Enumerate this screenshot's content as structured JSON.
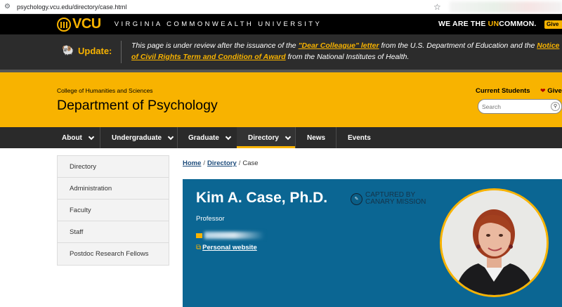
{
  "browser": {
    "url": "psychology.vcu.edu/directory/case.html"
  },
  "topbar": {
    "logo_text": "VCU",
    "university": "VIRGINIA COMMONWEALTH UNIVERSITY",
    "tagline_pre": "WE ARE THE ",
    "tagline_hl": "UN",
    "tagline_post": "COMMON.",
    "give_label": "Give"
  },
  "banner": {
    "label": "Update:",
    "text1": "This page is under review after the issuance of the ",
    "link1": "\"Dear Colleague\" letter",
    "text2": " from the U.S. Department of Education and the ",
    "link2": "Notice of Civil Rights Term and Condition of Award",
    "text3": " from the National Institutes of Health."
  },
  "header": {
    "college": "College of Humanities and Sciences",
    "department": "Department of Psychology",
    "current_students": "Current Students",
    "give": "Give",
    "search_placeholder": "Search"
  },
  "nav": {
    "items": [
      {
        "label": "About"
      },
      {
        "label": "Undergraduate"
      },
      {
        "label": "Graduate"
      },
      {
        "label": "Directory"
      },
      {
        "label": "News"
      },
      {
        "label": "Events"
      }
    ]
  },
  "sidebar": {
    "items": [
      {
        "label": "Directory"
      },
      {
        "label": "Administration"
      },
      {
        "label": "Faculty"
      },
      {
        "label": "Staff"
      },
      {
        "label": "Postdoc Research Fellows"
      }
    ]
  },
  "breadcrumb": {
    "home": "Home",
    "directory": "Directory",
    "current": "Case"
  },
  "profile": {
    "name": "Kim A. Case, Ph.D.",
    "title": "Professor",
    "website_label": "Personal website",
    "stamp_line1": "CAPTURED BY",
    "stamp_line2": "CANARY MISSION"
  },
  "colors": {
    "gold": "#f8b300",
    "black": "#000000",
    "profile_blue": "#0b6693",
    "nav_dark": "#2a2a2a"
  },
  "icons": {
    "browser_controls": "tune-icon",
    "bookmark": "star-icon",
    "banner": "ram-icon",
    "heart": "heart-icon",
    "search": "search-icon",
    "dropdown": "chevron-down-icon",
    "email": "envelope-icon",
    "website": "external-link-icon"
  }
}
